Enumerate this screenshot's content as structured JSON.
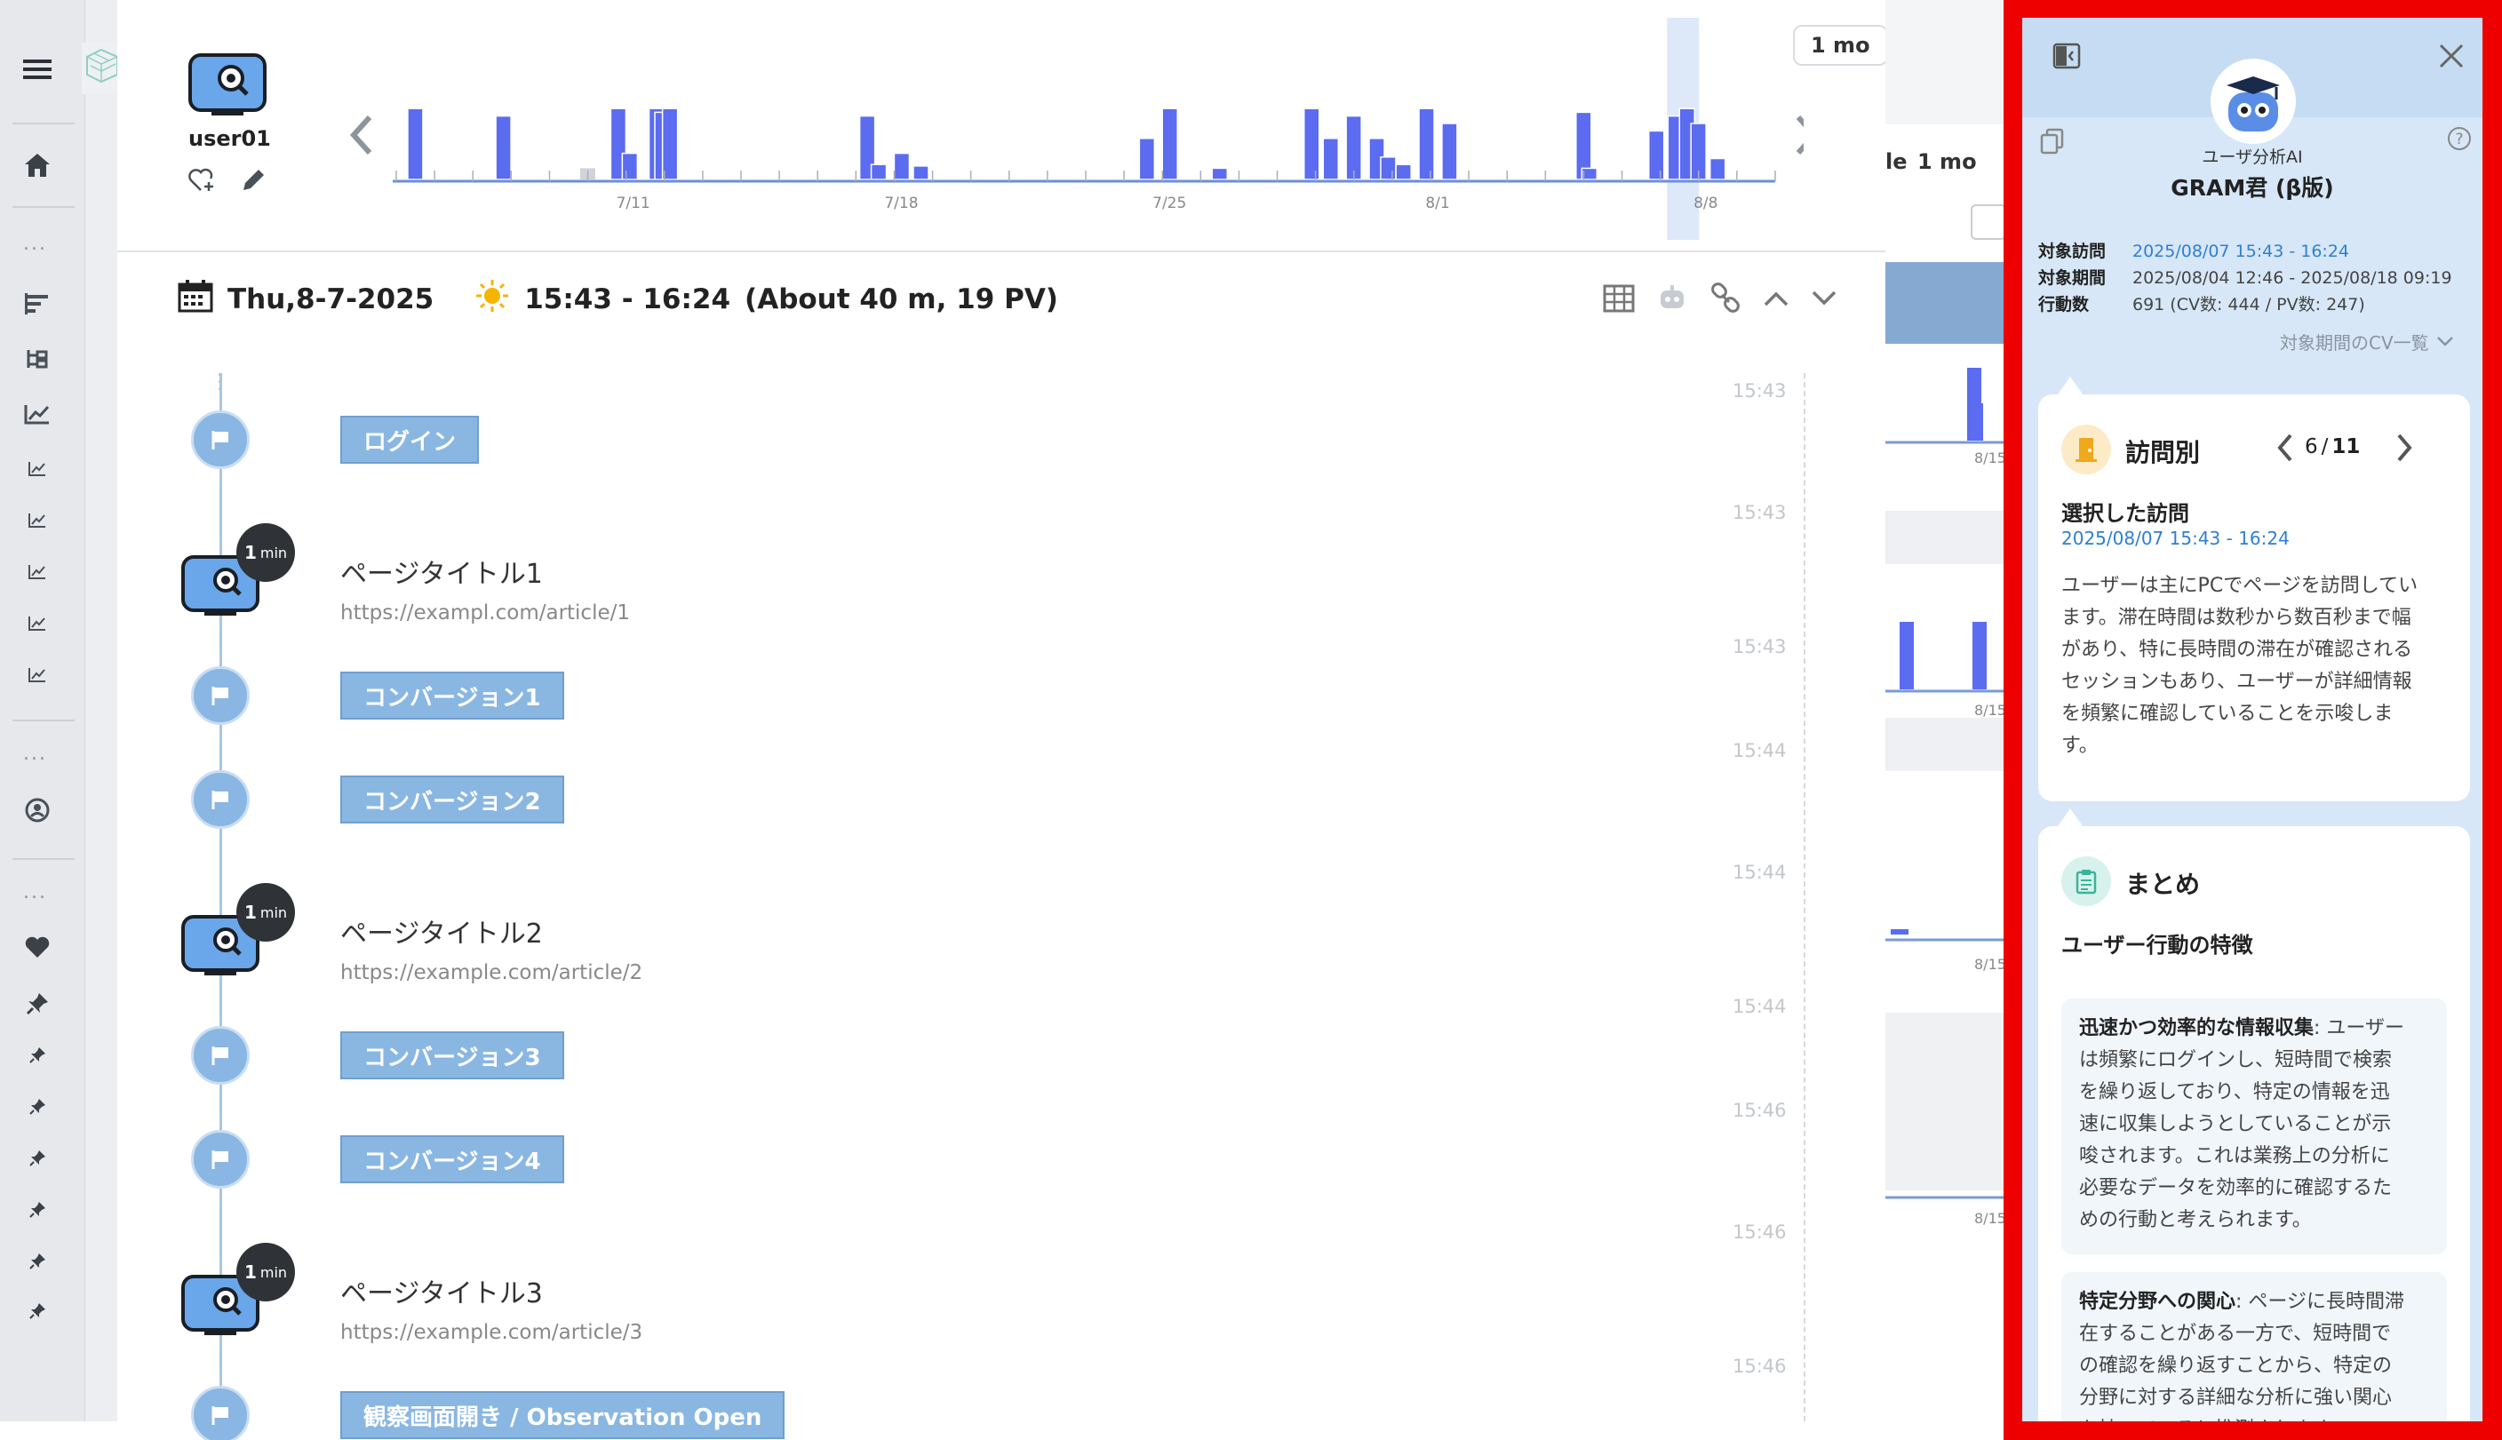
{
  "nav": {
    "items": [
      "menu-icon",
      "home-icon",
      "bars-icon",
      "tree-icon",
      "line-chart-icon",
      "chart-icon",
      "search-user-icon",
      "heart-icon",
      "pin-icon"
    ],
    "dots": "..."
  },
  "profile": {
    "username": "user01"
  },
  "timeline_chart": {
    "range_button": "1 mo",
    "x_ticks": [
      "7/11",
      "7/18",
      "7/25",
      "8/1",
      "8/8"
    ],
    "bars": [
      {
        "x": 0.3,
        "h": 0.95
      },
      {
        "x": 2.6,
        "h": 0.85
      },
      {
        "x": 4.8,
        "h": 0.15
      },
      {
        "x": 5.6,
        "h": 0.95
      },
      {
        "x": 5.9,
        "h": 0.35
      },
      {
        "x": 6.6,
        "h": 0.95
      },
      {
        "x": 6.75,
        "h": 0.9
      },
      {
        "x": 6.95,
        "h": 0.95
      },
      {
        "x": 12.1,
        "h": 0.85
      },
      {
        "x": 12.4,
        "h": 0.2
      },
      {
        "x": 13.0,
        "h": 0.35
      },
      {
        "x": 13.5,
        "h": 0.18
      },
      {
        "x": 19.4,
        "h": 0.55
      },
      {
        "x": 20.0,
        "h": 0.95
      },
      {
        "x": 21.3,
        "h": 0.15
      },
      {
        "x": 23.7,
        "h": 0.95
      },
      {
        "x": 24.2,
        "h": 0.55
      },
      {
        "x": 24.8,
        "h": 0.85
      },
      {
        "x": 25.4,
        "h": 0.55
      },
      {
        "x": 25.7,
        "h": 0.3
      },
      {
        "x": 26.1,
        "h": 0.2
      },
      {
        "x": 26.7,
        "h": 0.95
      },
      {
        "x": 27.3,
        "h": 0.75
      },
      {
        "x": 30.8,
        "h": 0.9
      },
      {
        "x": 30.95,
        "h": 0.15
      },
      {
        "x": 32.7,
        "h": 0.65
      },
      {
        "x": 33.2,
        "h": 0.85
      },
      {
        "x": 33.5,
        "h": 0.95
      },
      {
        "x": 33.8,
        "h": 0.75
      },
      {
        "x": 34.3,
        "h": 0.28
      }
    ],
    "ghost_bars": [
      {
        "x": 4.8,
        "h": 0.15
      }
    ],
    "highlight_x": 33.5
  },
  "session": {
    "date": "Thu,8-7-2025",
    "time_range": "15:43 - 16:24",
    "summary": "(About 40 m, 19 PV)"
  },
  "events": [
    {
      "type": "conversion",
      "label": "ログイン",
      "time": "15:43"
    },
    {
      "type": "page",
      "title": "ページタイトル1",
      "url": "https://exampl.com/article/1",
      "duration": "1",
      "unit": "min",
      "time": "15:43"
    },
    {
      "type": "conversion",
      "label": "コンバージョン1",
      "time": "15:43"
    },
    {
      "type": "conversion",
      "label": "コンバージョン2",
      "time": "15:44"
    },
    {
      "type": "page",
      "title": "ページタイトル2",
      "url": "https://example.com/article/2",
      "duration": "1",
      "unit": "min",
      "time": "15:44"
    },
    {
      "type": "conversion",
      "label": "コンバージョン3",
      "time": "15:44"
    },
    {
      "type": "conversion",
      "label": "コンバージョン4",
      "time": "15:46"
    },
    {
      "type": "page",
      "title": "ページタイトル3",
      "url": "https://example.com/article/3",
      "duration": "1",
      "unit": "min",
      "time": "15:46"
    },
    {
      "type": "conversion",
      "label": "観察画面開き / Observation Open",
      "time": "15:46"
    }
  ],
  "behind_panel": {
    "label_le": "le",
    "label_1mo": "1 mo",
    "tick": "8/15"
  },
  "panel": {
    "subtitle": "ユーザ分析AI",
    "title": "GRAM君 (β版)",
    "meta": [
      {
        "key": "対象訪問",
        "value": "2025/08/07 15:43 - 16:24",
        "accent": true
      },
      {
        "key": "対象期間",
        "value": "2025/08/04 12:46 - 2025/08/18 09:19",
        "accent": false
      },
      {
        "key": "行動数",
        "value": "691 (CV数: 444 / PV数: 247)",
        "accent": false
      }
    ],
    "cv_list_link": "対象期間のCV一覧",
    "visit_card": {
      "title": "訪問別",
      "pager_current": "6",
      "pager_sep": "/",
      "pager_total": "11",
      "section_title": "選択した訪問",
      "section_date": "2025/08/07 15:43 - 16:24",
      "body": [
        "ユーザーは主にPCでページを訪問してい",
        "ます。滞在時間は数秒から数百秒まで幅",
        "があり、特に長時間の滞在が確認される",
        "セッションもあり、ユーザーが詳細情報",
        "を頻繁に確認していることを示唆しま",
        "す。"
      ]
    },
    "summary_card": {
      "title": "まとめ",
      "section_title": "ユーザー行動の特徴",
      "point1_bold": "迅速かつ効率的な情報収集",
      "point1_lines": [
        ": ユーザー",
        "は頻繁にログインし、短時間で検索",
        "を繰り返しており、特定の情報を迅",
        "速に収集しようとしていることが示",
        "唆されます。これは業務上の分析に",
        "必要なデータを効率的に確認するた",
        "めの行動と考えられます。"
      ],
      "point2_bold": "特定分野への関心",
      "point2_lines": [
        ": ページに長時間滞",
        "在することがある一方で、短時間で",
        "の確認を繰り返すことから、特定の",
        "分野に対する詳細な分析に強い関心",
        "を持っていると推測されます。"
      ]
    }
  },
  "colors": {
    "accent": "#2f7fd1",
    "bar": "#5b6cf0",
    "panel_bg": "#d7e7f7",
    "frame": "#ee0000"
  }
}
